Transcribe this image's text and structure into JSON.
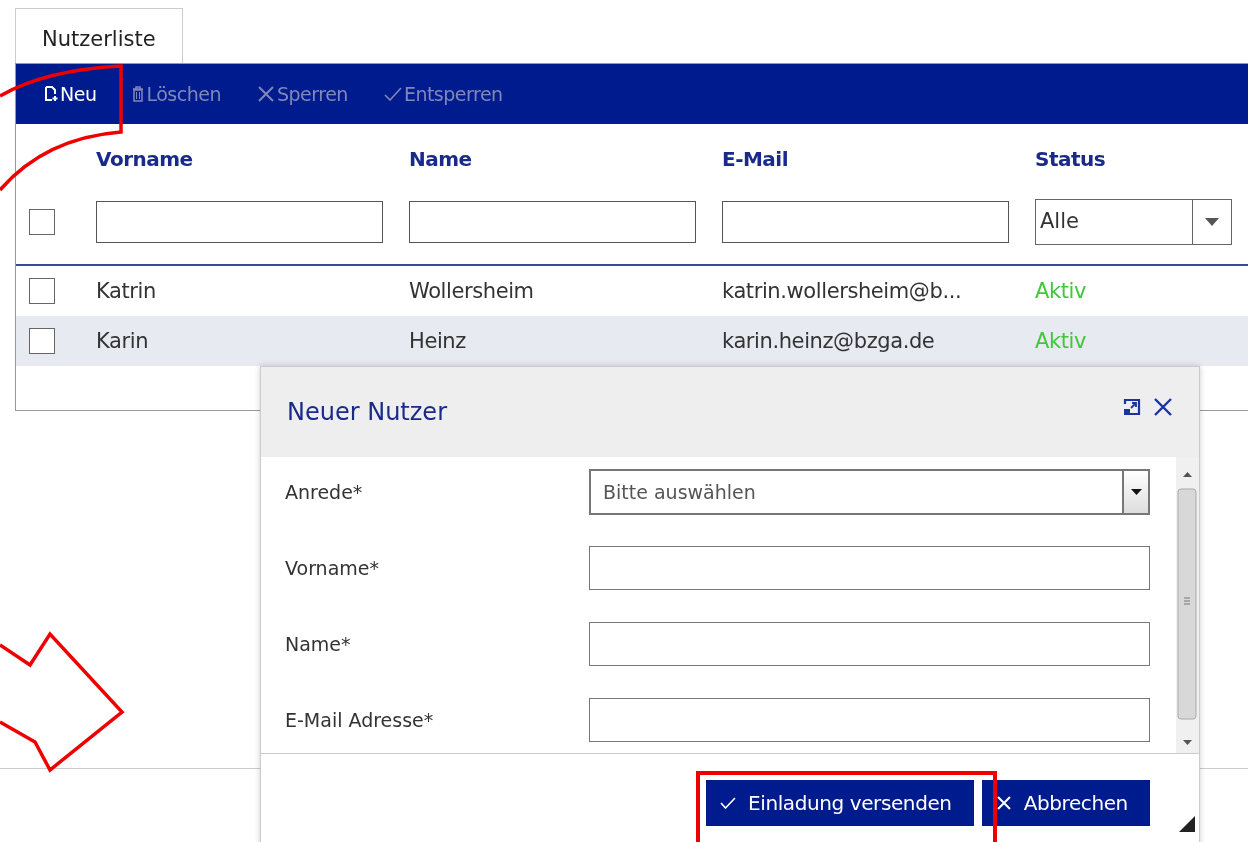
{
  "tabs": [
    {
      "label": "Nutzerliste",
      "selected": true
    }
  ],
  "toolbar": [
    {
      "label": "Neu",
      "kind": "new",
      "disabled": false
    },
    {
      "label": "Löschen",
      "kind": "delete",
      "disabled": true
    },
    {
      "label": "Sperren",
      "kind": "lock",
      "disabled": true
    },
    {
      "label": "Entsperren",
      "kind": "unlock",
      "disabled": true
    }
  ],
  "table": {
    "columns": [
      "Vorname",
      "Name",
      "E-Mail",
      "Status"
    ],
    "status_filter": {
      "value": "Alle"
    },
    "select_all_checked": false,
    "rows": [
      {
        "first_name": "Katrin",
        "name": "Wollersheim",
        "email": "katrin.wollersheim@b...",
        "status": "Aktiv",
        "color": "#3ec83a",
        "checked": false,
        "selected": false
      },
      {
        "first_name": "Karin",
        "name": "Heinz",
        "email": "karin.heinz@bzga.de",
        "status": "Aktiv",
        "color": "#3ec83a",
        "checked": false,
        "selected": true
      }
    ]
  },
  "dialog": {
    "title": "Neuer Nutzer",
    "fields": [
      {
        "label": "Anrede*",
        "kind": "select",
        "placeholder": "Bitte auswählen"
      },
      {
        "label": "Vorname*",
        "kind": "text"
      },
      {
        "label": "Name*",
        "kind": "text"
      },
      {
        "label": "E-Mail Adresse*",
        "kind": "text"
      }
    ],
    "buttons": [
      {
        "label": "Einladung versenden",
        "kind": "confirm"
      },
      {
        "label": "Abbrechen",
        "kind": "cancel"
      }
    ]
  }
}
